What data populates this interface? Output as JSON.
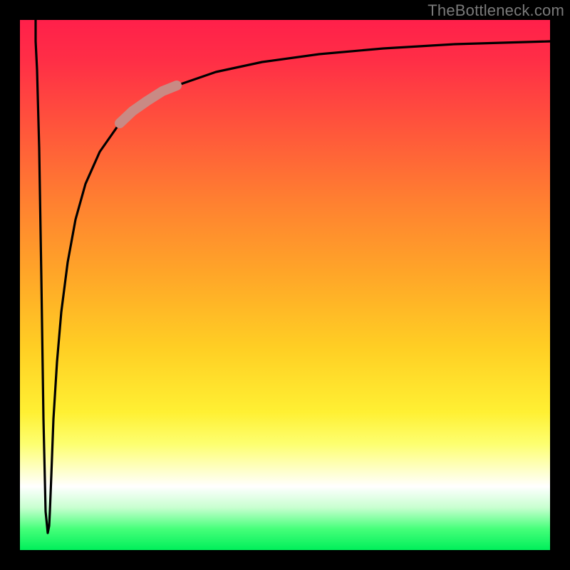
{
  "watermark": "TheBottleneck.com",
  "colors": {
    "frame": "#000000",
    "curve": "#000000",
    "highlight": "#c98a84"
  },
  "chart_data": {
    "type": "line",
    "title": "",
    "xlabel": "",
    "ylabel": "",
    "xlim": [
      0,
      100
    ],
    "ylim": [
      0,
      100
    ],
    "grid": false,
    "legend": false,
    "annotations": [
      "TheBottleneck.com"
    ],
    "series": [
      {
        "name": "bottleneck-curve",
        "x": [
          0,
          1,
          2,
          3,
          4,
          5,
          6,
          7,
          8,
          10,
          12,
          15,
          18,
          22,
          28,
          35,
          45,
          55,
          70,
          85,
          100
        ],
        "values": [
          100,
          60,
          20,
          3,
          14,
          26,
          37,
          46,
          53,
          63,
          70,
          77,
          81,
          85,
          88,
          91,
          93,
          94,
          95,
          95.5,
          96
        ]
      },
      {
        "name": "highlight-segment",
        "x": [
          18,
          22,
          28
        ],
        "values": [
          81,
          85,
          88
        ]
      }
    ]
  }
}
